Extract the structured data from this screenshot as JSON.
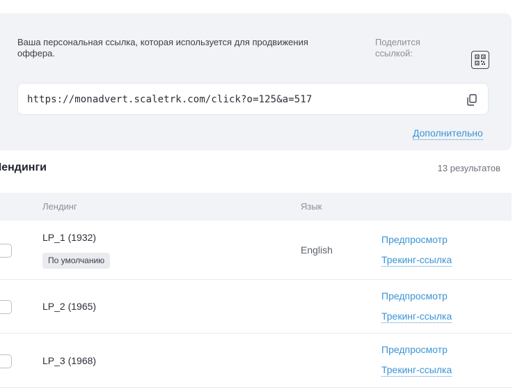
{
  "link_panel": {
    "description": "Ваша персональная ссылка, которая используется для продвижения оффера.",
    "share_label": "Поделится ссылкой:",
    "url": "https://monadvert.scaletrk.com/click?o=125&a=517",
    "more_link": "Дополнительно",
    "qr_icon": "qr-code-icon",
    "copy_icon": "copy-icon"
  },
  "landings": {
    "title": "Лендинги",
    "results": "13 результатов",
    "columns": {
      "landing": "Лендинг",
      "language": "Язык"
    },
    "rows": [
      {
        "name": "LP_1 (1932)",
        "badge": "По умолчанию",
        "language": "English",
        "preview": "Предпросмотр",
        "tracking": "Трекинг-ссылка"
      },
      {
        "name": "LP_2 (1965)",
        "preview": "Предпросмотр",
        "tracking": "Трекинг-ссылка"
      },
      {
        "name": "LP_3 (1968)",
        "preview": "Предпросмотр",
        "tracking": "Трекинг-ссылка"
      }
    ]
  },
  "colors": {
    "accent": "#3a93d6",
    "panel_bg": "#f1f3f6"
  }
}
